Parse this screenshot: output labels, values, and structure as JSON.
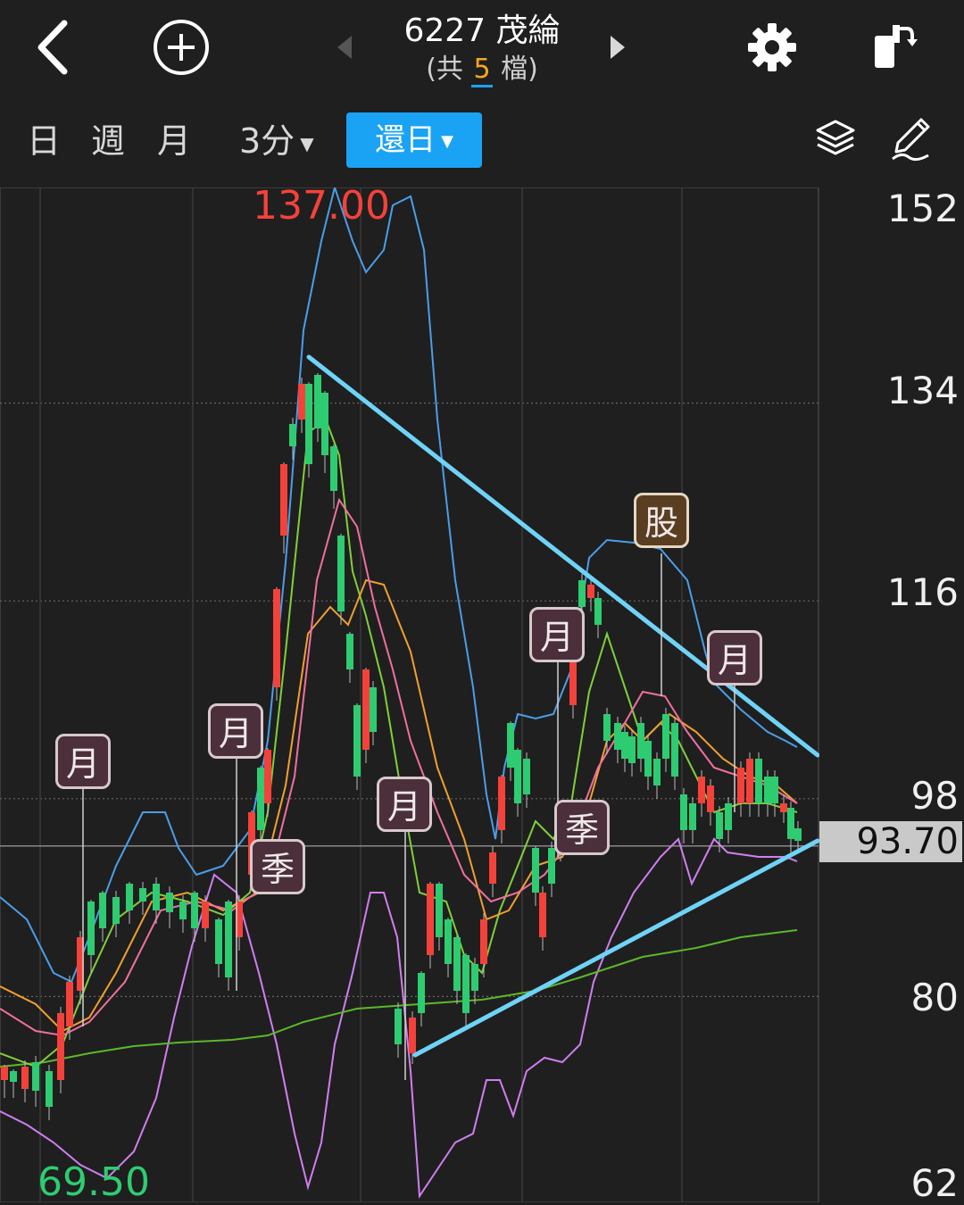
{
  "header": {
    "title": "6227 茂綸",
    "count_prefix": "(共",
    "count_num": "5",
    "count_suffix": "檔)"
  },
  "periods": {
    "day": "日",
    "week": "週",
    "month": "月",
    "minute": "3分",
    "restore": "還日"
  },
  "chart": {
    "high_label": "137.00",
    "low_label": "69.50",
    "current_price": "93.70",
    "axis_labels": [
      "152",
      "134",
      "116",
      "98",
      "80",
      "62"
    ],
    "events": [
      {
        "label": "月"
      },
      {
        "label": "月"
      },
      {
        "label": "季"
      },
      {
        "label": "月"
      },
      {
        "label": "月"
      },
      {
        "label": "季"
      },
      {
        "label": "股"
      },
      {
        "label": "月"
      }
    ],
    "colors": {
      "up": "#f4423b",
      "down": "#2ecc71",
      "trendline": "#6fd3f7",
      "boll_upper": "#4a9ee8",
      "boll_lower": "#d07ef0",
      "ma5": "#7fd03a",
      "ma10": "#f0a030",
      "ma20": "#f06fa0",
      "ma_long": "#5cb82a"
    }
  },
  "chart_data": {
    "type": "candlestick",
    "ylim": [
      62,
      152
    ],
    "y_ticks": [
      152,
      134,
      116,
      98,
      80,
      62
    ],
    "high": 137.0,
    "low": 69.5,
    "last": 93.7
  }
}
